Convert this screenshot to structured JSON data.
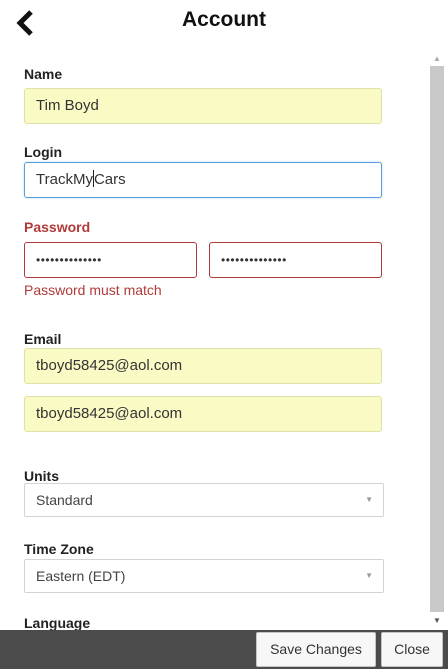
{
  "header": {
    "title": "Account",
    "back_icon": "chevron-left-icon"
  },
  "form": {
    "name": {
      "label": "Name",
      "value": "Tim Boyd"
    },
    "login": {
      "label": "Login",
      "value_before_caret": "TrackMy",
      "value_after_caret": "Cars"
    },
    "password": {
      "label": "Password",
      "value": "••••••••••••••",
      "confirm_value": "••••••••••••••",
      "error": "Password must match"
    },
    "email": {
      "label": "Email",
      "value": "tboyd58425@aol.com",
      "confirm_value": "tboyd58425@aol.com"
    },
    "units": {
      "label": "Units",
      "selected": "Standard"
    },
    "timezone": {
      "label": "Time Zone",
      "selected": "Eastern (EDT)"
    },
    "language": {
      "label": "Language"
    }
  },
  "footer": {
    "save_label": "Save Changes",
    "close_label": "Close"
  },
  "colors": {
    "error": "#b03a3a",
    "filled_background": "#fafbc4",
    "focus_border": "#5b9dd9",
    "footer_background": "#4b4b4b"
  }
}
